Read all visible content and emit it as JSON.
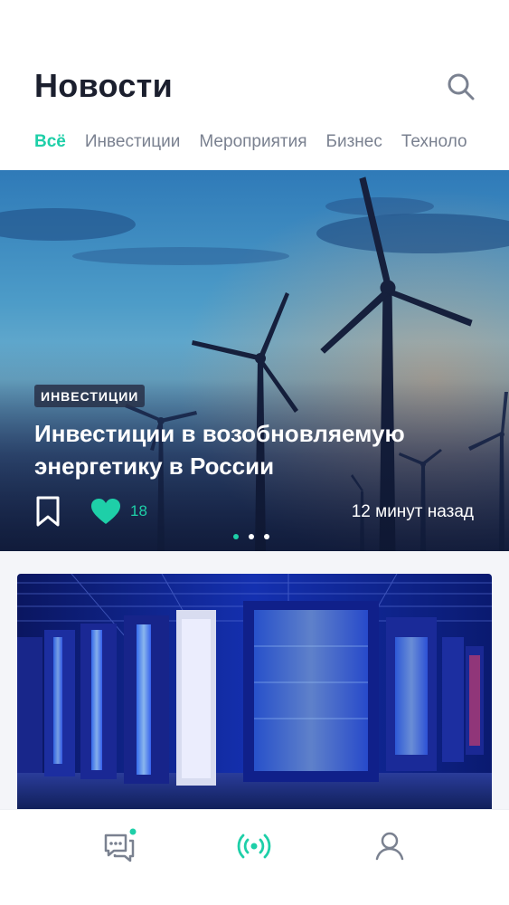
{
  "header": {
    "title": "Новости",
    "search_icon": "search-icon"
  },
  "tabs": [
    {
      "label": "Всё",
      "active": true
    },
    {
      "label": "Инвестиции",
      "active": false
    },
    {
      "label": "Мероприятия",
      "active": false
    },
    {
      "label": "Бизнес",
      "active": false
    },
    {
      "label": "Техноло",
      "active": false
    }
  ],
  "hero": {
    "badge": "ИНВЕСТИЦИИ",
    "title": "Инвестиции в возобновляемую энергетику в России",
    "likes": "18",
    "time": "12 минут назад",
    "slides": 3,
    "active_slide": 0
  },
  "bottom_nav": {
    "items": [
      {
        "icon": "chat-icon",
        "has_notification": true
      },
      {
        "icon": "broadcast-icon",
        "active": true
      },
      {
        "icon": "profile-icon"
      }
    ]
  },
  "colors": {
    "accent": "#1ecfa8",
    "title": "#1b1f2e",
    "muted": "#7a8190"
  }
}
